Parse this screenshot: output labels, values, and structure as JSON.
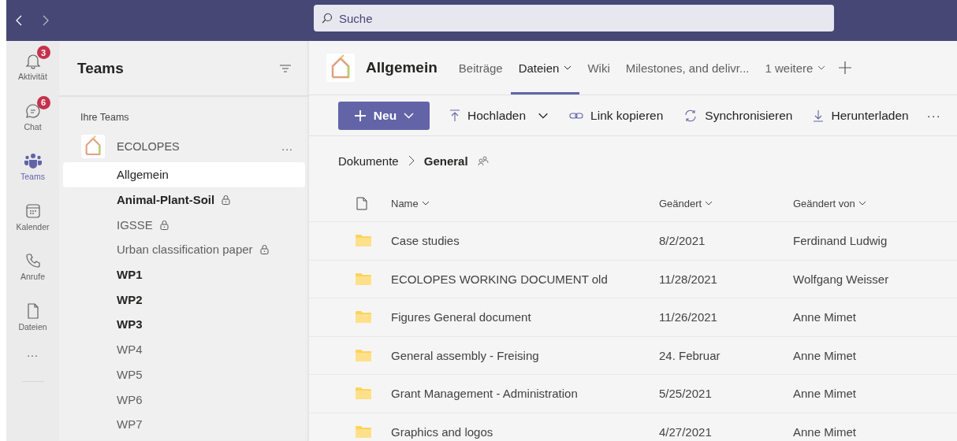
{
  "search": {
    "placeholder": "Suche"
  },
  "rail": [
    {
      "kind": "bell",
      "label": "Aktivität",
      "badge": "3",
      "selected": false
    },
    {
      "kind": "chat",
      "label": "Chat",
      "badge": "6",
      "selected": false
    },
    {
      "kind": "teams",
      "label": "Teams",
      "selected": true
    },
    {
      "kind": "calendar",
      "label": "Kalender",
      "selected": false
    },
    {
      "kind": "phone",
      "label": "Anrufe",
      "selected": false
    },
    {
      "kind": "file",
      "label": "Dateien",
      "selected": false
    }
  ],
  "rail_more": "...",
  "sidebar": {
    "title": "Teams",
    "section": "Ihre Teams",
    "team": {
      "name": "ECOLOPES",
      "more": "...",
      "channels": [
        {
          "name": "Allgemein",
          "selected": true,
          "unread": false,
          "private": false
        },
        {
          "name": "Animal-Plant-Soil",
          "selected": false,
          "unread": true,
          "private": true
        },
        {
          "name": "IGSSE",
          "selected": false,
          "unread": false,
          "private": true
        },
        {
          "name": "Urban classification paper",
          "selected": false,
          "unread": false,
          "private": true
        },
        {
          "name": "WP1",
          "selected": false,
          "unread": true,
          "private": false
        },
        {
          "name": "WP2",
          "selected": false,
          "unread": true,
          "private": false
        },
        {
          "name": "WP3",
          "selected": false,
          "unread": true,
          "private": false
        },
        {
          "name": "WP4",
          "selected": false,
          "unread": false,
          "private": false
        },
        {
          "name": "WP5",
          "selected": false,
          "unread": false,
          "private": false
        },
        {
          "name": "WP6",
          "selected": false,
          "unread": false,
          "private": false
        },
        {
          "name": "WP7",
          "selected": false,
          "unread": false,
          "private": false
        }
      ]
    }
  },
  "channel": {
    "title": "Allgemein",
    "tabs": [
      {
        "label": "Beiträge",
        "selected": false,
        "dropdown": false
      },
      {
        "label": "Dateien",
        "selected": true,
        "dropdown": true
      },
      {
        "label": "Wiki",
        "selected": false,
        "dropdown": false
      },
      {
        "label": "Milestones, and delivr...",
        "selected": false,
        "dropdown": false
      },
      {
        "label": "1 weitere",
        "selected": false,
        "dropdown": true
      }
    ]
  },
  "toolbar": [
    {
      "kind": "new",
      "label": "Neu"
    },
    {
      "kind": "upload",
      "label": "Hochladen"
    },
    {
      "kind": "link",
      "label": "Link kopieren"
    },
    {
      "kind": "sync",
      "label": "Synchronisieren"
    },
    {
      "kind": "download",
      "label": "Herunterladen"
    }
  ],
  "toolbar_more": "···",
  "breadcrumb": [
    "Dokumente",
    "General"
  ],
  "table": {
    "columns": [
      "Name",
      "Geändert",
      "Geändert von"
    ],
    "rows": [
      [
        "Case studies",
        "8/2/2021",
        "Ferdinand Ludwig"
      ],
      [
        "ECOLOPES WORKING DOCUMENT old",
        "11/28/2021",
        "Wolfgang Weisser"
      ],
      [
        "Figures General document",
        "11/26/2021",
        "Anne Mimet"
      ],
      [
        "General assembly - Freising",
        "24. Februar",
        "Anne Mimet"
      ],
      [
        "Grant Management - Administration",
        "5/25/2021",
        "Anne Mimet"
      ],
      [
        "Graphics and logos",
        "4/27/2021",
        "Anne Mimet"
      ]
    ]
  }
}
